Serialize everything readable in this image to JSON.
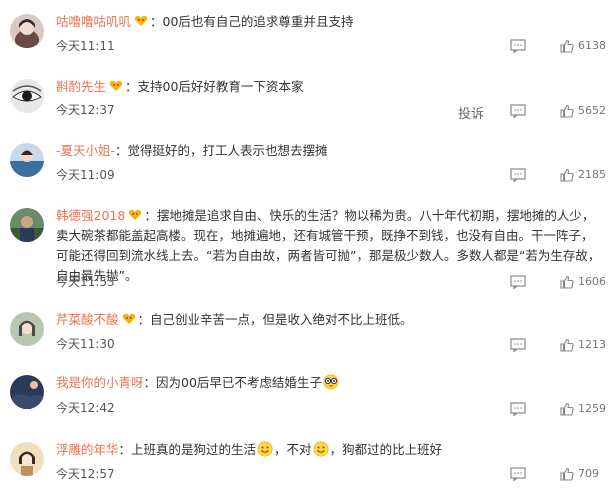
{
  "comments": [
    {
      "username": "咕噜噜咕叽叽",
      "has_badge": true,
      "text": "00后也有自己的追求尊重并且支持",
      "time": "今天11:11",
      "likes": "6138",
      "avatar_colors": [
        "#d9c9c4",
        "#3a2a2a"
      ]
    },
    {
      "username": "斟酌先生",
      "has_badge": true,
      "text": "支持00后好好教育一下资本家",
      "time": "今天12:37",
      "likes": "5652",
      "report_label": "投诉",
      "avatar_colors": [
        "#e8e8e8",
        "#1a1a1a"
      ]
    },
    {
      "username": "-夏天小姐-",
      "has_badge": false,
      "text": "觉得挺好的，打工人表示也想去摆摊",
      "time": "今天11:09",
      "likes": "2185",
      "avatar_colors": [
        "#3c6e9e",
        "#c8d8e8"
      ]
    },
    {
      "username": "韩德强2018",
      "has_badge": true,
      "text": "摆地摊是追求自由、快乐的生活？物以稀为贵。八十年代初期，摆地摊的人少，卖大碗茶都能盖起高楼。现在，地摊遍地，还有城管干预，既挣不到钱，也没有自由。干一阵子，可能还得回到流水线上去。“若为自由故，两者皆可抛”，那是极少数人。多数人都是“若为生存故，自由最先抛”。",
      "time": "今天11:53",
      "likes": "1606",
      "avatar_colors": [
        "#3a5a3a",
        "#c8b8a0"
      ]
    },
    {
      "username": "芹菜酸不酸",
      "has_badge": true,
      "text": "自己创业辛苦一点，但是收入绝对不比上班低。",
      "time": "今天11:30",
      "likes": "1213",
      "avatar_colors": [
        "#b8c8b0",
        "#4a4a4a"
      ]
    },
    {
      "username": "我是你的小青呀",
      "has_badge": false,
      "text": "因为00后早已不考虑结婚生子",
      "time": "今天12:42",
      "likes": "1259",
      "avatar_colors": [
        "#2a3a5a",
        "#e8c0a0"
      ]
    },
    {
      "username": "浮雕的年华",
      "has_badge": false,
      "text_parts": [
        "上班真的是狗过的生活",
        "，不对",
        "，狗都过的比上班好"
      ],
      "time": "今天12:57",
      "likes": "709",
      "avatar_colors": [
        "#f0e0c0",
        "#3a2a20"
      ]
    }
  ],
  "colors": {
    "username": "#eb7350",
    "text": "#333333",
    "meta": "#777777",
    "badge": "#f7b500"
  },
  "icons": {
    "reply": "comment-reply-icon",
    "like": "thumbs-up-icon"
  }
}
